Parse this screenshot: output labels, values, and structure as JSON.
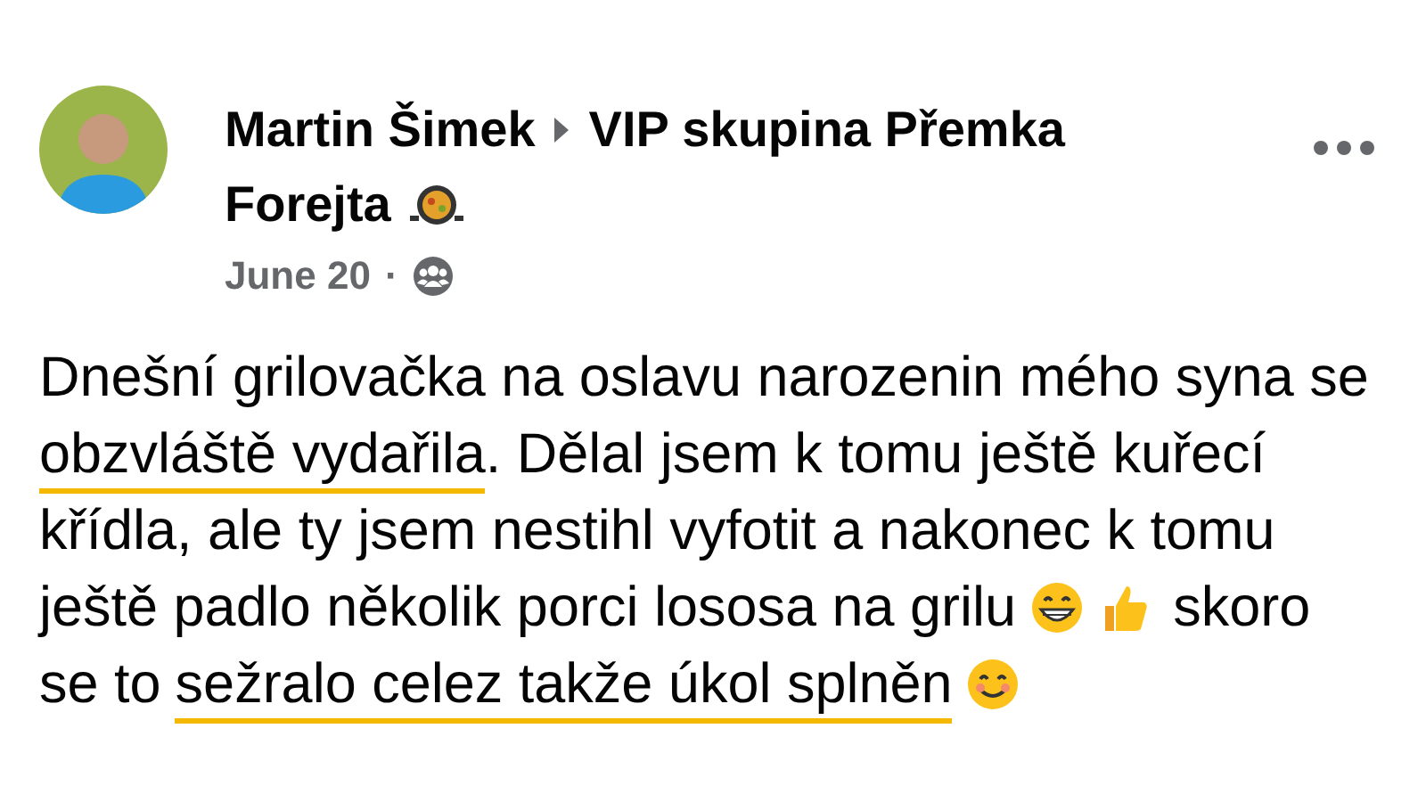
{
  "post": {
    "author": "Martin Šimek",
    "group_lines": [
      "VIP skupina Přemka",
      "Forejta"
    ],
    "date": "June 20",
    "separator": "·",
    "lines": [
      [
        {
          "kind": "text",
          "text": "Dnešní grilovačka na oslavu narozenin mého syna se",
          "marked": false
        }
      ],
      [
        {
          "kind": "text",
          "text": "obzvláště vydařila",
          "marked": true
        },
        {
          "kind": "text",
          "text": ". Dělal jsem k tomu ještě kuřecí",
          "marked": false
        }
      ],
      [
        {
          "kind": "text",
          "text": "křídla, ale ty jsem nestihl vyfotit a nakonec k tomu",
          "marked": false
        }
      ],
      [
        {
          "kind": "text",
          "text": "ještě padlo několik porci lososa na grilu",
          "marked": false
        },
        {
          "kind": "grin"
        },
        {
          "kind": "thumb"
        },
        {
          "kind": "text",
          "text": "skoro",
          "marked": false
        }
      ],
      [
        {
          "kind": "text",
          "text": "se to",
          "marked": false
        },
        {
          "kind": "text",
          "text": "sežralo celez takže úkol splněn",
          "marked": true
        },
        {
          "kind": "smile"
        }
      ]
    ]
  }
}
